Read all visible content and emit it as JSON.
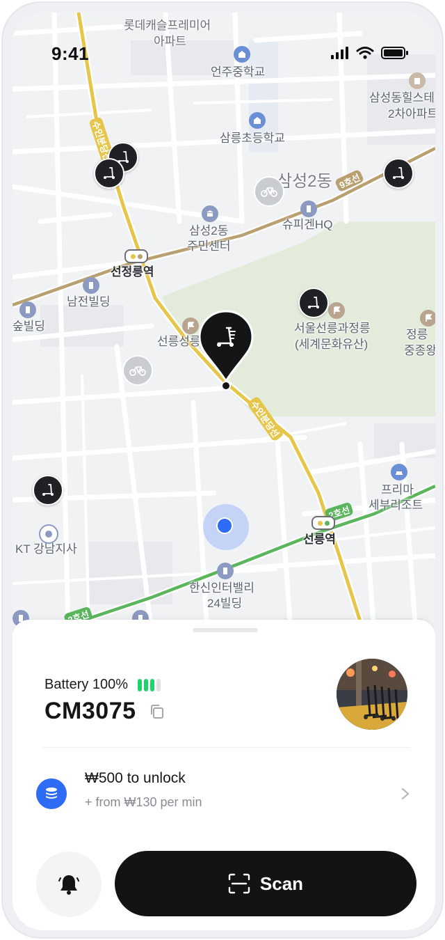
{
  "status_bar": {
    "time": "9:41"
  },
  "map": {
    "labels": {
      "lotte_castle": "롯데캐슬프레미어",
      "apartment": "아파트",
      "eonju_middle": "언주중학교",
      "samsung_hills": "삼성동힐스테",
      "apt2": "2차아파트",
      "samneung_elem": "삼릉초등학교",
      "samsung2dong": "삼성2동",
      "samsung2dong_center_1": "삼성2동",
      "samsung2dong_center_2": "주민센터",
      "supigen": "슈피겐HQ",
      "seonjeongneung_stn": "선정릉역",
      "namjeon": "남전빌딩",
      "bilding_left": "숲빌딩",
      "royal_tombs_1": "서울선릉과정릉",
      "royal_tombs_2": "(세계문화유산)",
      "jeongneung_1": "정릉",
      "jeongneung_2": "중종왕",
      "seonneung_partial": "선릉성릉",
      "line_suin": "수인분당선",
      "line_suin2": "수인분당선",
      "line_2ho": "2호선",
      "line_2ho_b": "2호선",
      "line_9ho": "9호선",
      "prima_1": "프리마",
      "prima_2": "세부리조트",
      "kt": "KT 강남지사",
      "seolleung_stn": "선릉역",
      "hanshin_1": "한신인터밸리",
      "hanshin_2": "24빌딩"
    }
  },
  "vehicle": {
    "battery_label": "Battery 100%",
    "battery_level": 1.0,
    "id": "CM3075"
  },
  "pricing": {
    "unlock": "₩500 to unlock",
    "per_min": "+ from ₩130 per min"
  },
  "actions": {
    "scan_label": "Scan"
  },
  "colors": {
    "accent_blue": "#2f6cf6",
    "battery_green": "#1fd36b",
    "scan_button": "#121315",
    "park_green": "#e3ecdb",
    "line_yellow": "#e6c64a",
    "line_green": "#5bb55c",
    "line_brown": "#b8a070"
  }
}
